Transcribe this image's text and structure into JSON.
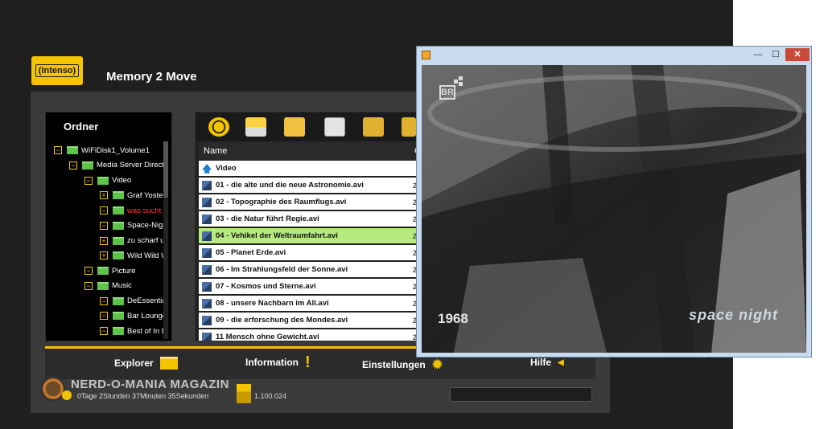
{
  "app": {
    "logo_text": "(Intenso)",
    "title": "Memory 2 Move"
  },
  "ordner": {
    "title": "Ordner",
    "tree": [
      {
        "label": "WiFiDisk1_Volume1",
        "expander": "−",
        "red": false
      },
      {
        "label": "Media Server Directo",
        "expander": "−",
        "red": false
      },
      {
        "label": "Video",
        "expander": "−",
        "red": false
      },
      {
        "label": "Graf Yoster",
        "expander": "+",
        "red": false
      },
      {
        "label": "was sucht c",
        "expander": "−",
        "red": true
      },
      {
        "label": "Space-Nigh",
        "expander": "−",
        "red": false
      },
      {
        "label": "zu scharf ui",
        "expander": "+",
        "red": false
      },
      {
        "label": "Wild Wild W",
        "expander": "+",
        "red": false
      },
      {
        "label": "Picture",
        "expander": "−",
        "red": false
      },
      {
        "label": "Music",
        "expander": "−",
        "red": false
      },
      {
        "label": "DeEssentia",
        "expander": "−",
        "red": false
      },
      {
        "label": "Bar Lounge",
        "expander": "−",
        "red": false
      },
      {
        "label": "Best of In D",
        "expander": "−",
        "red": false
      }
    ]
  },
  "toolbar": {
    "icons": [
      "settings-gear-icon",
      "upload-icon",
      "new-folder-icon",
      "copy-icon",
      "move-icon",
      "more-icon"
    ]
  },
  "file_list": {
    "header_name": "Name",
    "header_second": "G",
    "rows": [
      {
        "name": "Video",
        "icon": "up-arrow-icon",
        "selected": false,
        "col2": ""
      },
      {
        "name": "01 - die alte und die neue Astronomie.avi",
        "icon": "video-file-icon",
        "selected": false,
        "col2": "2"
      },
      {
        "name": "02 - Topographie des Raumflugs.avi",
        "icon": "video-file-icon",
        "selected": false,
        "col2": "2"
      },
      {
        "name": "03 - die Natur führt Regie.avi",
        "icon": "video-file-icon",
        "selected": false,
        "col2": "2"
      },
      {
        "name": "04 - Vehikel der Weltraumfahrt.avi",
        "icon": "video-file-icon",
        "selected": true,
        "col2": "2"
      },
      {
        "name": "05 - Planet Erde.avi",
        "icon": "video-file-icon",
        "selected": false,
        "col2": "2"
      },
      {
        "name": "06 - Im Strahlungsfeld der Sonne.avi",
        "icon": "video-file-icon",
        "selected": false,
        "col2": "2"
      },
      {
        "name": "07 - Kosmos und Sterne.avi",
        "icon": "video-file-icon",
        "selected": false,
        "col2": "2"
      },
      {
        "name": "08 - unsere Nachbarn im All.avi",
        "icon": "video-file-icon",
        "selected": false,
        "col2": "2"
      },
      {
        "name": "09 - die erforschung des Mondes.avi",
        "icon": "video-file-icon",
        "selected": false,
        "col2": "2"
      },
      {
        "name": "11 Mensch ohne Gewicht.avi",
        "icon": "video-file-icon",
        "selected": false,
        "col2": "2"
      }
    ]
  },
  "tabs": {
    "explorer": "Explorer",
    "information": "Information",
    "einstellungen": "Einstellungen",
    "hilfe": "Hilfe"
  },
  "status": {
    "watermark": "NERD-O-MANIA MAGAZIN",
    "uptime": "0Tage 2Stunden 37Minuten 35Sekunden",
    "count": "1.100.024"
  },
  "video_window": {
    "controls": {
      "minimize": "—",
      "maximize": "☐",
      "close": "✕"
    },
    "overlay_year": "1968",
    "overlay_logo_text": "BR",
    "overlay_brand": "space night"
  },
  "colors": {
    "accent": "#f5c400",
    "selected_row": "#b6ea7e",
    "folder": "#5ec24b",
    "red_item": "#ff3a3a"
  }
}
